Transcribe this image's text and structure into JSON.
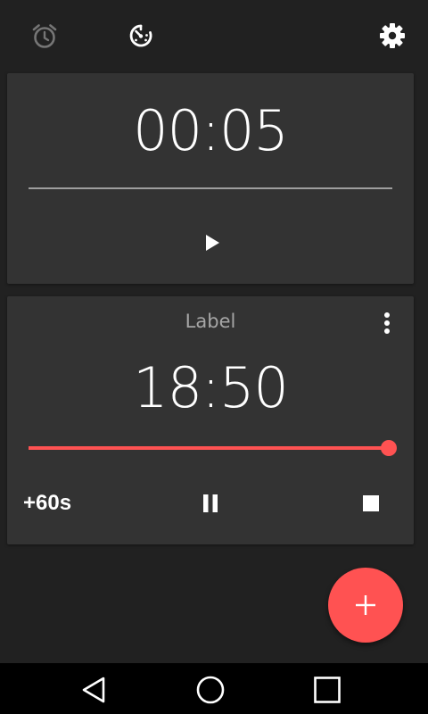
{
  "toolbar": {
    "icons": {
      "alarm": "alarm-icon",
      "timer": "timer-icon",
      "settings": "gear-icon"
    }
  },
  "timers": [
    {
      "time": "00:05",
      "state": "paused",
      "progress": 0.0,
      "progress_color": "#9e9e9e",
      "actions": {
        "primary": "play-icon"
      }
    },
    {
      "label": "Label",
      "time": "18:50",
      "state": "running",
      "progress": 1.0,
      "progress_color": "#ff5252",
      "actions": {
        "add_time": "+60s",
        "primary": "pause-icon",
        "stop": "stop-icon",
        "menu": "more-vert-icon"
      }
    }
  ],
  "fab": {
    "icon": "add-icon",
    "color": "#ff5252"
  },
  "nav": {
    "icons": [
      "back-icon",
      "home-icon",
      "recents-icon"
    ]
  },
  "colors": {
    "background": "#212121",
    "card": "#333333",
    "accent": "#ff5252"
  }
}
